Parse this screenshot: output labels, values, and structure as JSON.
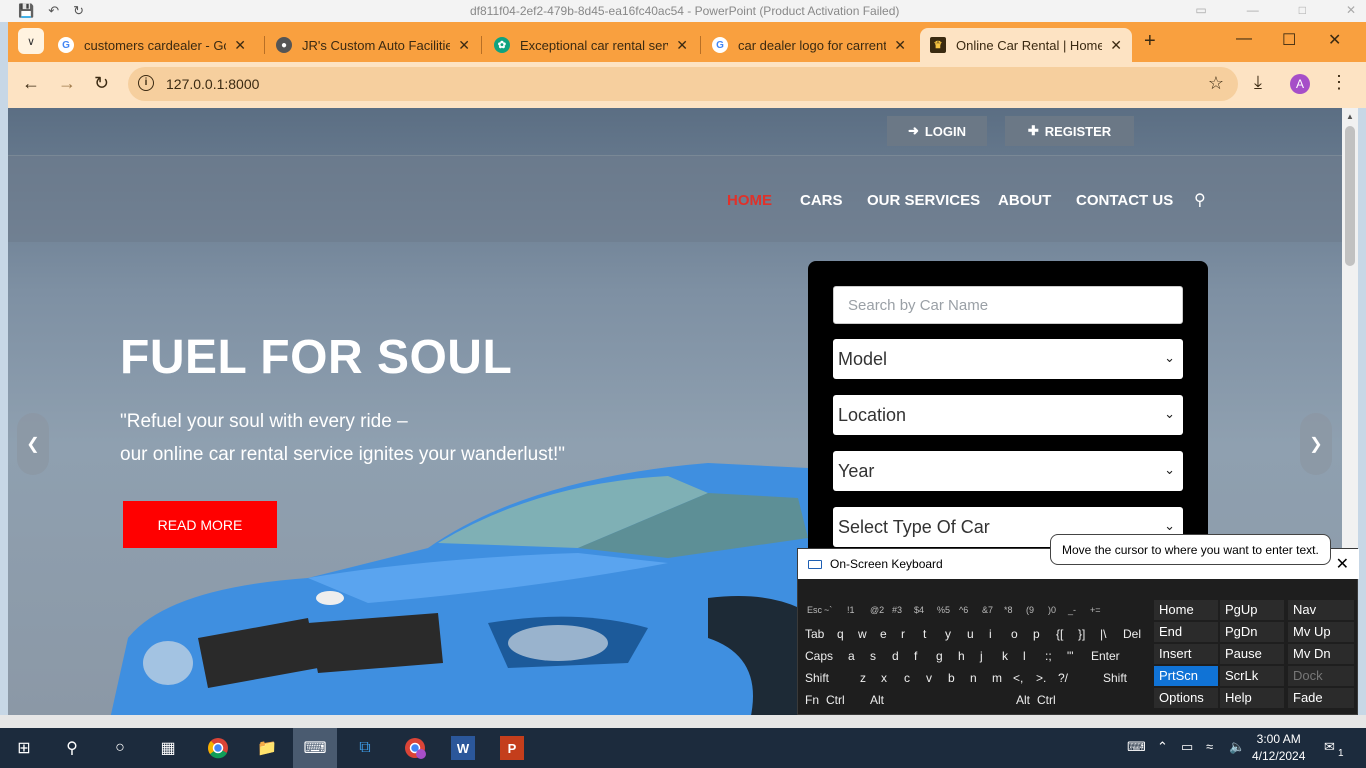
{
  "ppt": {
    "title": "df811f04-2ef2-479b-8d45-ea16fc40ac54 - PowerPoint (Product Activation Failed)"
  },
  "browser": {
    "tabs": [
      {
        "label": "customers cardealer - Goog",
        "favicon": "google-icon"
      },
      {
        "label": "JR's Custom Auto Facilities",
        "favicon": "globe-icon"
      },
      {
        "label": "Exceptional car rental servic",
        "favicon": "chatgpt-icon"
      },
      {
        "label": "car dealer logo for carrental",
        "favicon": "google-icon"
      },
      {
        "label": "Online Car Rental | Home",
        "favicon": "site-icon"
      }
    ],
    "url": "127.0.0.1:8000",
    "avatar_letter": "A"
  },
  "site": {
    "auth": {
      "login": "LOGIN",
      "register": "REGISTER"
    },
    "nav": [
      "HOME",
      "CARS",
      "OUR SERVICES",
      "ABOUT",
      "CONTACT US"
    ],
    "hero": {
      "title": "FUEL FOR SOUL",
      "line1": "\"Refuel your soul with every ride –",
      "line2": "our online car rental service ignites your wanderlust!\"",
      "button": "READ MORE"
    },
    "search": {
      "placeholder": "Search by Car Name",
      "model": "Model",
      "location": "Location",
      "year": "Year",
      "type": "Select Type Of Car"
    }
  },
  "osk": {
    "title": "On-Screen Keyboard",
    "tooltip": "Move the cursor to where you want to enter text.",
    "row1": [
      "Esc",
      "~`",
      "!1",
      "@2",
      "#3",
      "$4",
      "%5",
      "^6",
      "&7",
      "*8",
      "(9",
      ")0",
      "_-",
      "+="
    ],
    "row2": [
      "Tab",
      "q",
      "w",
      "e",
      "r",
      "t",
      "y",
      "u",
      "i",
      "o",
      "p",
      "{[",
      "}]",
      "|\\",
      "Del"
    ],
    "row3": [
      "Caps",
      "a",
      "s",
      "d",
      "f",
      "g",
      "h",
      "j",
      "k",
      "l",
      ":;",
      "\"'",
      "Enter"
    ],
    "row4": [
      "Shift",
      "z",
      "x",
      "c",
      "v",
      "b",
      "n",
      "m",
      "<,",
      ">.",
      "?/",
      "Shift"
    ],
    "row5": [
      "Fn",
      "Ctrl",
      "Alt",
      "Alt",
      "Ctrl"
    ],
    "nav_keys": [
      [
        "Home",
        "PgUp",
        "Nav"
      ],
      [
        "End",
        "PgDn",
        "Mv Up"
      ],
      [
        "Insert",
        "Pause",
        "Mv Dn"
      ],
      [
        "PrtScn",
        "ScrLk",
        "Dock"
      ],
      [
        "Options",
        "Help",
        "Fade"
      ]
    ]
  },
  "taskbar": {
    "time": "3:00 AM",
    "date": "4/12/2024",
    "notifications": "1"
  }
}
